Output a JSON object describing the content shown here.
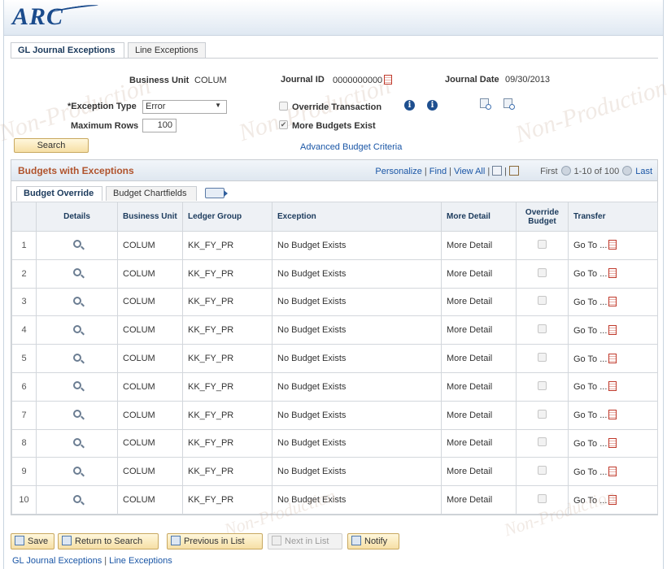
{
  "app": {
    "logo": "ARC"
  },
  "tabs": [
    {
      "label": "GL Journal Exceptions",
      "active": true
    },
    {
      "label": "Line Exceptions",
      "active": false
    }
  ],
  "watermark": "Non-Production",
  "form": {
    "business_unit_label": "Business Unit",
    "business_unit_value": "COLUM",
    "journal_id_label": "Journal ID",
    "journal_id_value": "0000000000",
    "journal_date_label": "Journal Date",
    "journal_date_value": "09/30/2013",
    "exception_type_label": "*Exception Type",
    "exception_type_value": "Error",
    "max_rows_label": "Maximum Rows",
    "max_rows_value": "100",
    "override_label": "Override Transaction",
    "override_checked": false,
    "more_budgets_label": "More Budgets Exist",
    "more_budgets_checked": true,
    "search_label": "Search",
    "advanced_link": "Advanced Budget Criteria"
  },
  "grid": {
    "title": "Budgets with Exceptions",
    "nav": {
      "personalize": "Personalize",
      "find": "Find",
      "view_all": "View All",
      "first": "First",
      "range": "1-10 of 100",
      "last": "Last"
    },
    "subtabs": [
      {
        "label": "Budget Override",
        "active": true
      },
      {
        "label": "Budget Chartfields",
        "active": false
      }
    ],
    "columns": {
      "details": "Details",
      "business_unit": "Business Unit",
      "ledger_group": "Ledger Group",
      "exception": "Exception",
      "more_detail": "More Detail",
      "override_budget": "Override Budget",
      "transfer": "Transfer"
    },
    "rows": [
      {
        "num": "1",
        "business_unit": "COLUM",
        "ledger_group": "KK_FY_PR",
        "exception": "No Budget Exists",
        "more_detail": "More Detail",
        "transfer": "Go To ..."
      },
      {
        "num": "2",
        "business_unit": "COLUM",
        "ledger_group": "KK_FY_PR",
        "exception": "No Budget Exists",
        "more_detail": "More Detail",
        "transfer": "Go To ..."
      },
      {
        "num": "3",
        "business_unit": "COLUM",
        "ledger_group": "KK_FY_PR",
        "exception": "No Budget Exists",
        "more_detail": "More Detail",
        "transfer": "Go To ..."
      },
      {
        "num": "4",
        "business_unit": "COLUM",
        "ledger_group": "KK_FY_PR",
        "exception": "No Budget Exists",
        "more_detail": "More Detail",
        "transfer": "Go To ..."
      },
      {
        "num": "5",
        "business_unit": "COLUM",
        "ledger_group": "KK_FY_PR",
        "exception": "No Budget Exists",
        "more_detail": "More Detail",
        "transfer": "Go To ..."
      },
      {
        "num": "6",
        "business_unit": "COLUM",
        "ledger_group": "KK_FY_PR",
        "exception": "No Budget Exists",
        "more_detail": "More Detail",
        "transfer": "Go To ..."
      },
      {
        "num": "7",
        "business_unit": "COLUM",
        "ledger_group": "KK_FY_PR",
        "exception": "No Budget Exists",
        "more_detail": "More Detail",
        "transfer": "Go To ..."
      },
      {
        "num": "8",
        "business_unit": "COLUM",
        "ledger_group": "KK_FY_PR",
        "exception": "No Budget Exists",
        "more_detail": "More Detail",
        "transfer": "Go To ..."
      },
      {
        "num": "9",
        "business_unit": "COLUM",
        "ledger_group": "KK_FY_PR",
        "exception": "No Budget Exists",
        "more_detail": "More Detail",
        "transfer": "Go To ..."
      },
      {
        "num": "10",
        "business_unit": "COLUM",
        "ledger_group": "KK_FY_PR",
        "exception": "No Budget Exists",
        "more_detail": "More Detail",
        "transfer": "Go To ..."
      }
    ]
  },
  "toolbar": {
    "save": "Save",
    "return_to_search": "Return to Search",
    "previous_in_list": "Previous in List",
    "next_in_list": "Next in List",
    "notify": "Notify"
  },
  "footer": {
    "link1": "GL Journal Exceptions",
    "link2": "Line Exceptions"
  },
  "colors": {
    "accent_blue": "#1a4b8c",
    "grid_title": "#b0532c",
    "link": "#1a56a6",
    "button_gold": "#f6dfa5"
  }
}
